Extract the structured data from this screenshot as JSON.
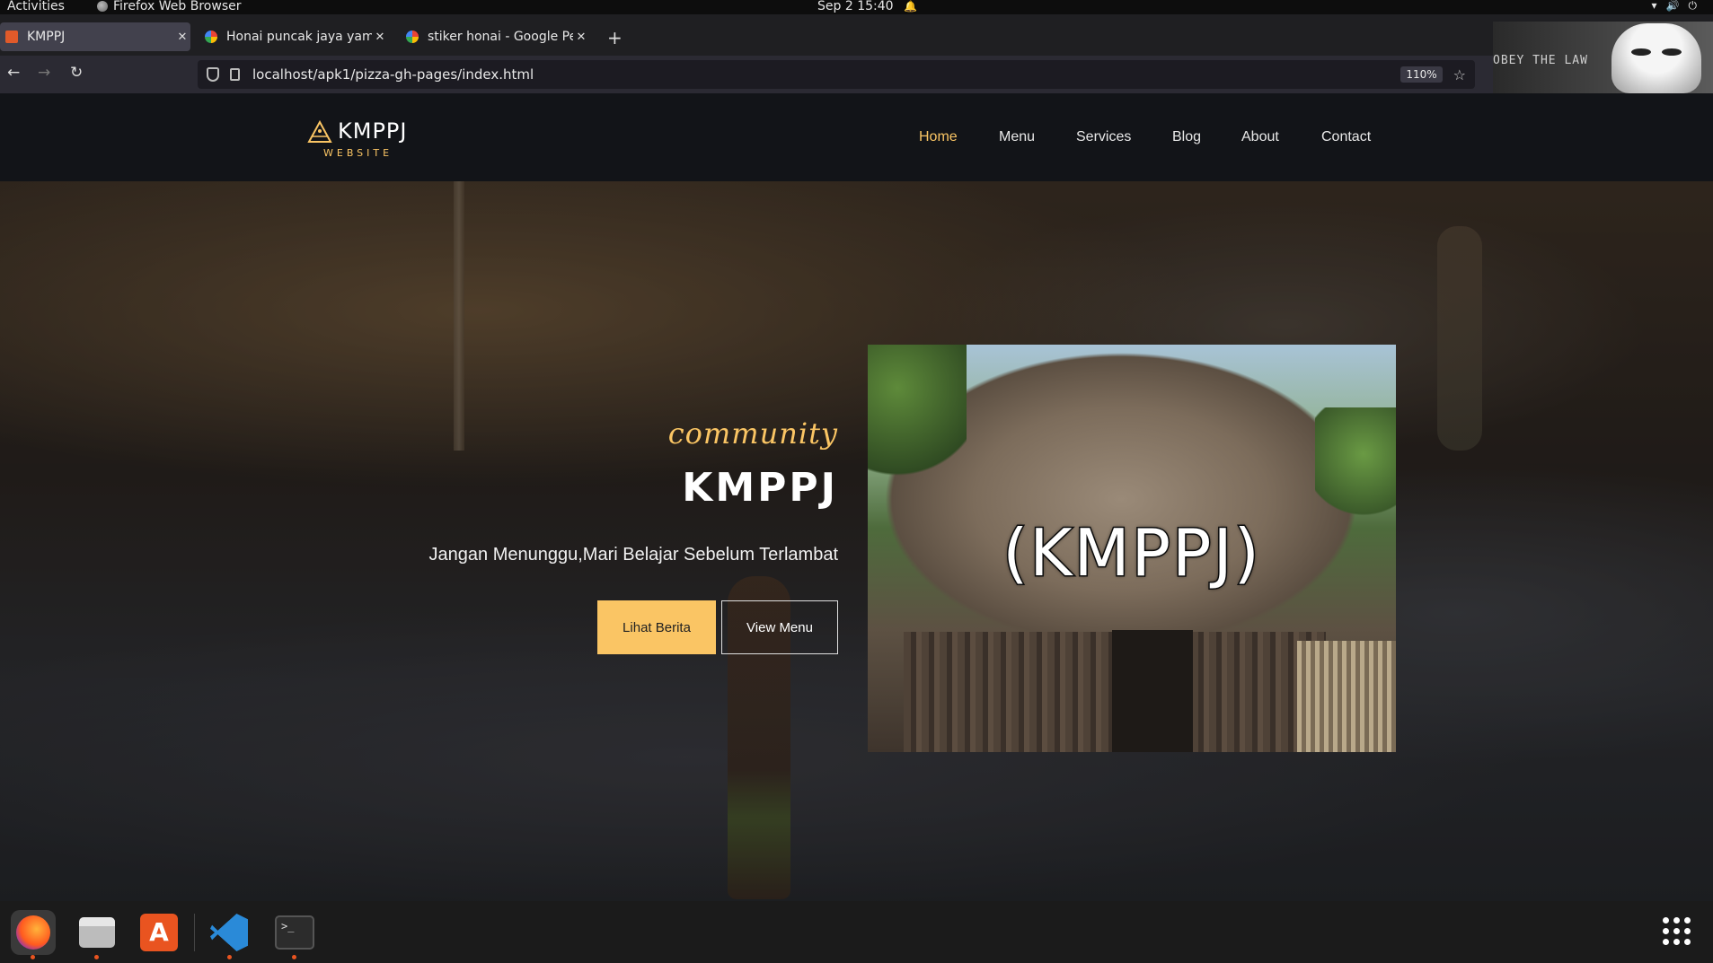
{
  "system": {
    "activities": "Activities",
    "app_name": "Firefox Web Browser",
    "clock": "Sep 2  15:40"
  },
  "browser": {
    "tabs": [
      {
        "title": "KMPPJ",
        "active": true
      },
      {
        "title": "Honai puncak jaya yamo",
        "active": false
      },
      {
        "title": "stiker honai - Google Pen",
        "active": false
      }
    ],
    "url": "localhost/apk1/pizza-gh-pages/index.html",
    "zoom": "110%",
    "wallpaper_text": "OBEY THE LAW"
  },
  "site": {
    "logo": {
      "name": "KMPPJ",
      "sub": "WEBSITE"
    },
    "nav": [
      {
        "label": "Home",
        "active": true
      },
      {
        "label": "Menu",
        "active": false
      },
      {
        "label": "Services",
        "active": false
      },
      {
        "label": "Blog",
        "active": false
      },
      {
        "label": "About",
        "active": false
      },
      {
        "label": "Contact",
        "active": false
      }
    ],
    "hero": {
      "kicker": "community",
      "title": "KMPPJ",
      "tagline": "Jangan Menunggu,Mari Belajar Sebelum Terlambat",
      "primary_button": "Lihat Berita",
      "secondary_button": "View Menu",
      "image_text": "(KMPPJ)",
      "slides": 3,
      "active_slide": 1
    },
    "accent_color": "#fac564"
  },
  "dock": {
    "apps": [
      "firefox-icon",
      "files-icon",
      "software-store-icon",
      "vscode-icon",
      "terminal-icon"
    ],
    "terminal_prompt": ">_"
  }
}
